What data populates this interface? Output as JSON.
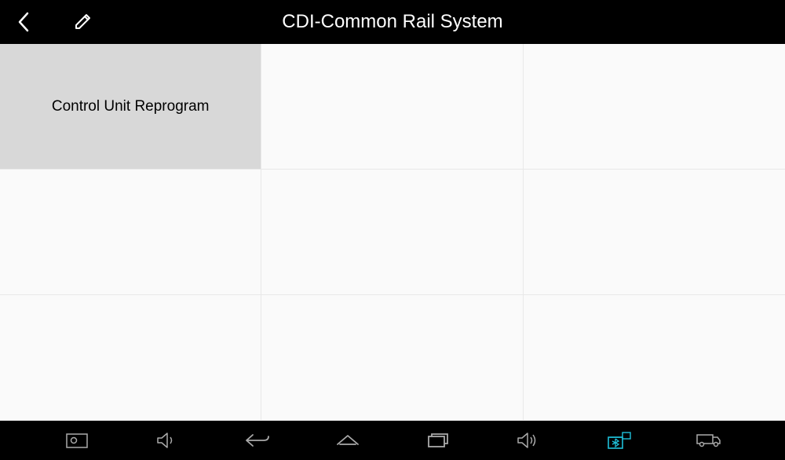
{
  "header": {
    "title": "CDI-Common Rail System"
  },
  "grid": {
    "items": [
      {
        "label": "Control Unit Reprogram",
        "active": true
      },
      {
        "label": "",
        "active": false
      },
      {
        "label": "",
        "active": false
      },
      {
        "label": "",
        "active": false
      },
      {
        "label": "",
        "active": false
      },
      {
        "label": "",
        "active": false
      },
      {
        "label": "",
        "active": false
      },
      {
        "label": "",
        "active": false
      },
      {
        "label": "",
        "active": false
      }
    ]
  }
}
